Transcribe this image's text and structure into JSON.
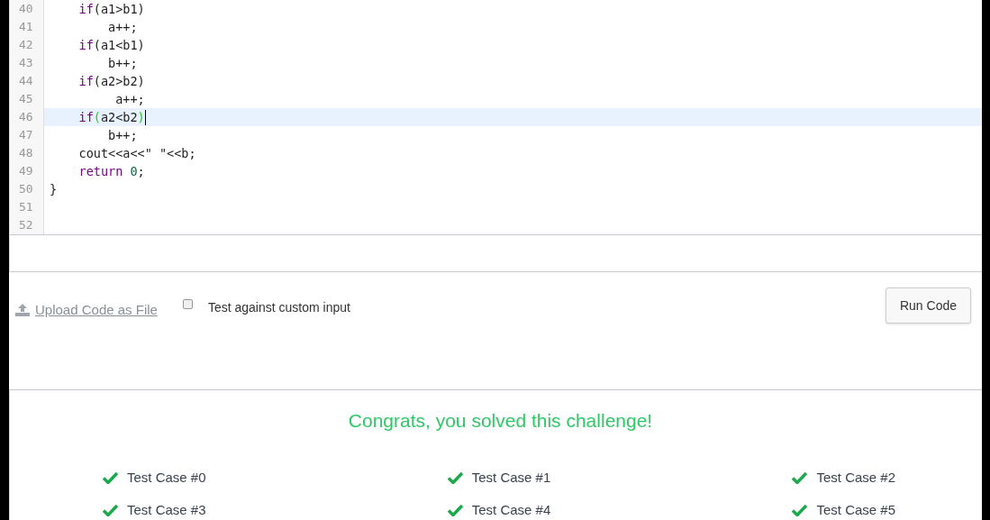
{
  "editor": {
    "lines": [
      {
        "number": "40",
        "active": false,
        "tokens": [
          {
            "kind": "keyword",
            "text": "    if"
          },
          {
            "kind": "plain",
            "text": "(a1>b1)"
          }
        ]
      },
      {
        "number": "41",
        "active": false,
        "tokens": [
          {
            "kind": "plain",
            "text": "        a++;"
          }
        ]
      },
      {
        "number": "42",
        "active": false,
        "tokens": [
          {
            "kind": "keyword",
            "text": "    if"
          },
          {
            "kind": "plain",
            "text": "(a1<b1)"
          }
        ]
      },
      {
        "number": "43",
        "active": false,
        "tokens": [
          {
            "kind": "plain",
            "text": "        b++;"
          }
        ]
      },
      {
        "number": "44",
        "active": false,
        "tokens": [
          {
            "kind": "keyword",
            "text": "    if"
          },
          {
            "kind": "plain",
            "text": "(a2>b2)"
          }
        ]
      },
      {
        "number": "45",
        "active": false,
        "tokens": [
          {
            "kind": "plain",
            "text": "         a++;"
          }
        ]
      },
      {
        "number": "46",
        "active": true,
        "tokens": [
          {
            "kind": "keyword",
            "text": "    if"
          },
          {
            "kind": "match",
            "text": "("
          },
          {
            "kind": "plain",
            "text": "a2<b2"
          },
          {
            "kind": "match",
            "text": ")"
          }
        ]
      },
      {
        "number": "47",
        "active": false,
        "tokens": [
          {
            "kind": "plain",
            "text": "        b++;"
          }
        ]
      },
      {
        "number": "48",
        "active": false,
        "tokens": [
          {
            "kind": "plain",
            "text": "    cout<<a<<\" \"<<b;"
          }
        ]
      },
      {
        "number": "49",
        "active": false,
        "tokens": [
          {
            "kind": "keyword",
            "text": "    return"
          },
          {
            "kind": "number",
            "text": " 0"
          },
          {
            "kind": "plain",
            "text": ";"
          }
        ]
      },
      {
        "number": "50",
        "active": false,
        "tokens": [
          {
            "kind": "plain",
            "text": "}"
          }
        ]
      },
      {
        "number": "51",
        "active": false
      },
      {
        "number": "52",
        "active": false
      }
    ]
  },
  "actions": {
    "upload_link": "Upload Code as File",
    "custom_input": {
      "label": "Test against custom input",
      "checked": false
    },
    "run_button": "Run Code"
  },
  "result": {
    "message": "Congrats, you solved this challenge!",
    "test_cases": [
      {
        "label": "Test Case #0",
        "passed": true
      },
      {
        "label": "Test Case #1",
        "passed": true
      },
      {
        "label": "Test Case #2",
        "passed": true
      },
      {
        "label": "Test Case #3",
        "passed": true
      },
      {
        "label": "Test Case #4",
        "passed": true
      },
      {
        "label": "Test Case #5",
        "passed": true
      }
    ]
  }
}
